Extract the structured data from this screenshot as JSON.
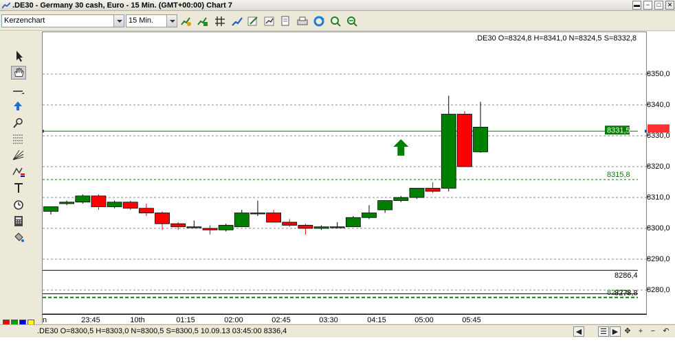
{
  "window": {
    "title": ".DE30 - Germany 30 cash, Euro - 15 Min. (GMT+00:00)   Chart 7",
    "buttons": [
      "minimize-button",
      "restore-button",
      "maximize-button",
      "close-button"
    ]
  },
  "toolbar": {
    "chart_type": "Kerzenchart",
    "timeframe": "15 Min.",
    "icons": [
      "indicator-icon",
      "indicator-add-icon",
      "grid-icon",
      "trend-icon",
      "edit-icon",
      "objects-icon",
      "copy-icon",
      "print-icon",
      "refresh-icon",
      "zoom-in-icon",
      "zoom-out-icon"
    ]
  },
  "left_tools": [
    "cursor-arrow-icon",
    "hand-pan-icon",
    "horizontal-line-icon",
    "arrow-marker-icon",
    "zoom-tool-icon",
    "fibonacci-icon",
    "gann-fan-icon",
    "pattern-icon",
    "text-tool-icon",
    "alarm-clock-icon",
    "calculator-icon",
    "paint-bucket-icon"
  ],
  "swatches": {
    "top": [
      "#ff0000",
      "#00a000",
      "#0000ff",
      "#ffff00"
    ],
    "bottom": [
      "#ffffff",
      "#000000",
      "#800000",
      "#606060"
    ]
  },
  "ohlc_header": ".DE30 O=8324,8 H=8341,0 N=8324,5 S=8332,8",
  "statusbar": {
    "text": ".DE30 O=8300,5 H=8303,0 N=8300,5 S=8300,5   10.09.13 03:45:00 8336,4"
  },
  "colors": {
    "up": "#008000",
    "down": "#ff0000",
    "current_line": "#008000",
    "current_badge_bg": "#008000",
    "red_badge_bg": "#ff3030"
  },
  "chart_data": {
    "type": "candlestick",
    "ylim": [
      8275,
      8360
    ],
    "yticks": [
      "8350,0",
      "8340,0",
      "8330,0",
      "8320,0",
      "8310,0",
      "8300,0",
      "8290,0",
      "8280,0"
    ],
    "ytick_values": [
      8350,
      8340,
      8330,
      8320,
      8310,
      8300,
      8290,
      8280
    ],
    "xticks": [
      "23:45",
      "10th",
      "01:15",
      "02:00",
      "02:45",
      "03:30",
      "04:15",
      "05:00",
      "05:45"
    ],
    "xtick_label_left": "n",
    "candles": [
      {
        "o": 8305.5,
        "h": 8307.0,
        "c": 8307.0,
        "l": 8304.5
      },
      {
        "o": 8308.0,
        "h": 8309.0,
        "c": 8308.5,
        "l": 8307.5
      },
      {
        "o": 8308.5,
        "h": 8311.0,
        "c": 8310.5,
        "l": 8308.0
      },
      {
        "o": 8310.5,
        "h": 8311.0,
        "c": 8307.0,
        "l": 8306.0
      },
      {
        "o": 8307.0,
        "h": 8309.0,
        "c": 8308.5,
        "l": 8306.5
      },
      {
        "o": 8308.5,
        "h": 8309.0,
        "c": 8306.5,
        "l": 8306.0
      },
      {
        "o": 8306.5,
        "h": 8308.0,
        "c": 8305.0,
        "l": 8304.0
      },
      {
        "o": 8305.0,
        "h": 8305.5,
        "c": 8301.5,
        "l": 8299.5
      },
      {
        "o": 8301.5,
        "h": 8302.0,
        "c": 8300.5,
        "l": 8299.5
      },
      {
        "o": 8300.5,
        "h": 8302.5,
        "c": 8300.5,
        "l": 8300.0
      },
      {
        "o": 8300.0,
        "h": 8301.0,
        "c": 8299.5,
        "l": 8298.0
      },
      {
        "o": 8299.5,
        "h": 8301.5,
        "c": 8301.0,
        "l": 8299.0
      },
      {
        "o": 8300.5,
        "h": 8306.0,
        "c": 8305.0,
        "l": 8300.5
      },
      {
        "o": 8305.0,
        "h": 8309.0,
        "c": 8305.0,
        "l": 8304.0
      },
      {
        "o": 8305.0,
        "h": 8306.0,
        "c": 8302.0,
        "l": 8302.0
      },
      {
        "o": 8302.0,
        "h": 8303.0,
        "c": 8301.0,
        "l": 8300.5
      },
      {
        "o": 8301.0,
        "h": 8301.5,
        "c": 8300.0,
        "l": 8298.0
      },
      {
        "o": 8300.0,
        "h": 8301.0,
        "c": 8300.5,
        "l": 8299.5
      },
      {
        "o": 8300.5,
        "h": 8302.0,
        "c": 8300.5,
        "l": 8300.0
      },
      {
        "o": 8300.5,
        "h": 8304.0,
        "c": 8303.5,
        "l": 8300.5
      },
      {
        "o": 8303.5,
        "h": 8307.5,
        "c": 8305.0,
        "l": 8303.0
      },
      {
        "o": 8306.0,
        "h": 8309.0,
        "c": 8309.0,
        "l": 8305.0
      },
      {
        "o": 8309.0,
        "h": 8310.5,
        "c": 8310.0,
        "l": 8308.5
      },
      {
        "o": 8310.0,
        "h": 8313.0,
        "c": 8313.0,
        "l": 8309.5
      },
      {
        "o": 8313.0,
        "h": 8315.0,
        "c": 8312.0,
        "l": 8311.5
      },
      {
        "o": 8313.0,
        "h": 8343.0,
        "c": 8337.0,
        "l": 8312.0
      },
      {
        "o": 8337.0,
        "h": 8338.0,
        "c": 8320.0,
        "l": 8320.0
      },
      {
        "o": 8324.8,
        "h": 8341.0,
        "c": 8332.8,
        "l": 8324.5
      }
    ],
    "levels": [
      {
        "label": "8331,5",
        "value": 8331.5,
        "style": "current"
      },
      {
        "label": "8315,8",
        "value": 8315.8,
        "style": "dashed-green"
      },
      {
        "label": "8286,4",
        "value": 8286.4,
        "style": "solid-black"
      },
      {
        "label": "8277,6",
        "value": 8277.6,
        "style": "dashed-green-thick"
      },
      {
        "label": "8278,8",
        "value": 8278.8,
        "style": "solid-black-thin"
      }
    ],
    "arrow_marker": {
      "candle_index": 22,
      "value": 8326,
      "direction": "up"
    }
  }
}
